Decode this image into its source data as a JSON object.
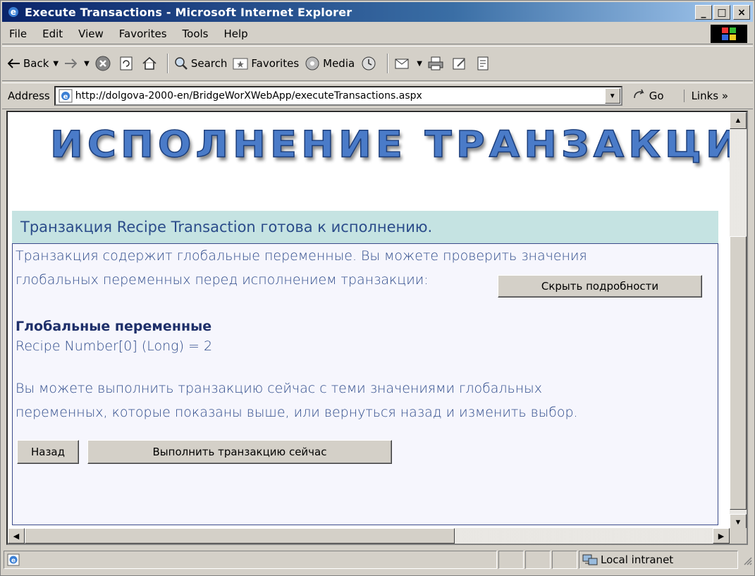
{
  "window": {
    "title": "Execute Transactions - Microsoft Internet Explorer",
    "minimize": "_",
    "maximize": "□",
    "close": "×"
  },
  "menu": {
    "items": [
      "File",
      "Edit",
      "View",
      "Favorites",
      "Tools",
      "Help"
    ]
  },
  "toolbar": {
    "back": "Back",
    "search": "Search",
    "favorites": "Favorites",
    "media": "Media"
  },
  "address": {
    "label": "Address",
    "url": "http://dolgova-2000-en/BridgeWorXWebApp/executeTransactions.aspx",
    "go": "Go",
    "links": "Links »"
  },
  "page": {
    "banner": "ИСПОЛНЕНИЕ ТРАНЗАКЦИЙ",
    "status_line": "Транзакция Recipe Transaction готова к исполнению.",
    "intro_line1": "Транзакция содержит глобальные переменные. Вы можете проверить значения",
    "intro_line2": "глобальных переменных перед исполнением транзакции:",
    "hide_details_button": "Скрыть подробности",
    "globals_heading": "Глобальные переменные",
    "global_var": "Recipe Number[0] (Long) = 2",
    "note_line1": "Вы можете выполнить транзакцию сейчас с теми значениями глобальных",
    "note_line2": "переменных, которые показаны выше, или вернуться назад и изменить выбор.",
    "back_button": "Назад",
    "execute_button": "Выполнить транзакцию сейчас"
  },
  "statusbar": {
    "zone": "Local intranet"
  },
  "colors": {
    "title_bar": "#0a246a",
    "status_band": "#c5e3e2",
    "text_blue": "#2d4a8a"
  }
}
